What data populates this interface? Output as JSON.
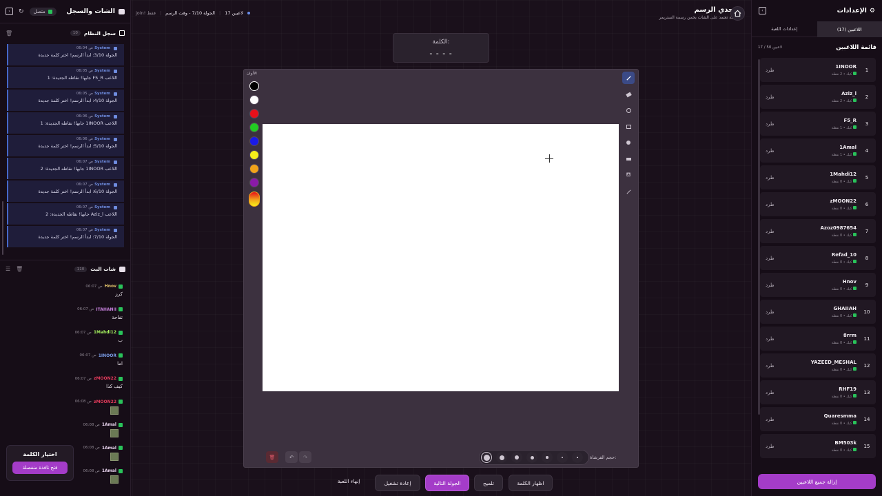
{
  "left": {
    "title": "الشات والسجل",
    "status": "متصل",
    "system_log": {
      "title": "سجل النظام",
      "count": "10"
    },
    "logs": [
      {
        "user": "System",
        "time": "06:04 ص",
        "msg": "الجولة 3/10: ابدأ الرسم! اختر كلمة جديدة"
      },
      {
        "user": "System",
        "time": "06:05 ص",
        "msg": "اللاعب F5_R جابها! نقاطه الجديدة: 1"
      },
      {
        "user": "System",
        "time": "06:05 ص",
        "msg": "الجولة 4/10: ابدأ الرسم! اختر كلمة جديدة"
      },
      {
        "user": "System",
        "time": "06:06 ص",
        "msg": "اللاعب 1INOOR جابها! نقاطه الجديدة: 1"
      },
      {
        "user": "System",
        "time": "06:06 ص",
        "msg": "الجولة 5/10: ابدأ الرسم! اختر كلمة جديدة"
      },
      {
        "user": "System",
        "time": "06:07 ص",
        "msg": "اللاعب 1INOOR جابها! نقاطه الجديدة: 2"
      },
      {
        "user": "System",
        "time": "06:07 ص",
        "msg": "الجولة 6/10: ابدأ الرسم! اختر كلمة جديدة"
      },
      {
        "user": "System",
        "time": "06:07 ص",
        "msg": "اللاعب Aziz_l جابها! نقاطه الجديدة: 2"
      },
      {
        "user": "System",
        "time": "06:07 ص",
        "msg": "الجولة 7/10: ابدأ الرسم! اختر كلمة جديدة"
      }
    ],
    "live_chat": {
      "title": "شات البث",
      "count": "110"
    },
    "chat": [
      {
        "name": "Hnov",
        "time": "06:07 ص",
        "text": "كرز",
        "color": "#e3c36a",
        "thumb": false
      },
      {
        "name": "ITAHANII",
        "time": "06:07 ص",
        "text": "تفاحة",
        "color": "#c27fd8",
        "thumb": false
      },
      {
        "name": "1Mahdi12",
        "time": "06:07 ص",
        "text": "ب",
        "color": "#a4f05e",
        "thumb": false
      },
      {
        "name": "1INOOR",
        "time": "06:07 ص",
        "text": "اما",
        "color": "#7a9de8",
        "thumb": false
      },
      {
        "name": "zMOON22",
        "time": "06:07 ص",
        "text": "كيف كذا",
        "color": "#e03a5a",
        "thumb": false
      },
      {
        "name": "zMOON22",
        "time": "06:08 ص",
        "text": "",
        "color": "#e03a5a",
        "thumb": true
      },
      {
        "name": "1Amal",
        "time": "06:08 ص",
        "text": "",
        "color": "#e8d4ee",
        "thumb": true
      },
      {
        "name": "1Amal",
        "time": "06:08 ص",
        "text": "",
        "color": "#e8d4ee",
        "thumb": true
      },
      {
        "name": "1Amal",
        "time": "06:08 ص",
        "text": "",
        "color": "#e8d4ee",
        "thumb": true
      }
    ],
    "pick_word": {
      "title": "اختيار الكلمة",
      "button": "فتح نافذة منفصلة"
    }
  },
  "top": {
    "game_title": "تحدي الرسم",
    "subtitle": "لعبة تعتمد على الشات يخمن رسمة الستريمر",
    "players_count": "17 لاعبين",
    "round_info": "الجولة 7/10 - وقت الرسم",
    "join_note": "join! فقط"
  },
  "word_box": {
    "label": "الكلمة:",
    "mask": "- - - -"
  },
  "canvas": {
    "colors_label": "الألوان",
    "brush_label": "حجم الفرشاة:"
  },
  "colors": [
    "#000000",
    "#ffffff",
    "#e8101a",
    "#22cc22",
    "#1a1ae8",
    "#f7ee1a",
    "#f2a41a",
    "#8a1aa8"
  ],
  "bottom": {
    "end_game": "إنهاء اللعبة",
    "restart": "إعادة تشغيل",
    "next_round": "الجولة التالية",
    "hint": "تلميح",
    "reveal_word": "اظهار الكلمة"
  },
  "right": {
    "title": "الإعدادات",
    "tab_players": "اللاعبين (17)",
    "tab_settings": "إعدادات اللعبة",
    "list_title": "قائمة اللاعبين",
    "list_count": "17 / 50 لاعبين",
    "kick_label": "طرد",
    "remove_all": "إزالة جميع اللاعبين",
    "players": [
      {
        "rank": "1",
        "name": "1INOOR",
        "sub": "كيك • 2 نقطة"
      },
      {
        "rank": "2",
        "name": "Aziz_l",
        "sub": "كيك • 2 نقطة"
      },
      {
        "rank": "3",
        "name": "F5_R",
        "sub": "كيك • 1 نقطة"
      },
      {
        "rank": "4",
        "name": "1Amal",
        "sub": "كيك • 1 نقطة"
      },
      {
        "rank": "5",
        "name": "1Mahdi12",
        "sub": "كيك • 0 نقطة"
      },
      {
        "rank": "6",
        "name": "zMOON22",
        "sub": "كيك • 0 نقطة"
      },
      {
        "rank": "7",
        "name": "Azoz0987654",
        "sub": "كيك • 0 نقطة"
      },
      {
        "rank": "8",
        "name": "Refad_10",
        "sub": "كيك • 0 نقطة"
      },
      {
        "rank": "9",
        "name": "Hnov",
        "sub": "كيك • 0 نقطة"
      },
      {
        "rank": "10",
        "name": "GHAIIAH",
        "sub": "كيك • 0 نقطة"
      },
      {
        "rank": "11",
        "name": "8rrm",
        "sub": "كيك • 0 نقطة"
      },
      {
        "rank": "12",
        "name": "YAZEED_MESHAL",
        "sub": "كيك • 0 نقطة"
      },
      {
        "rank": "13",
        "name": "RHF19",
        "sub": "كيك • 0 نقطة"
      },
      {
        "rank": "14",
        "name": "Quaresmma",
        "sub": "كيك • 0 نقطة"
      },
      {
        "rank": "15",
        "name": "BM503k",
        "sub": "كيك • 0 نقطة"
      }
    ]
  }
}
